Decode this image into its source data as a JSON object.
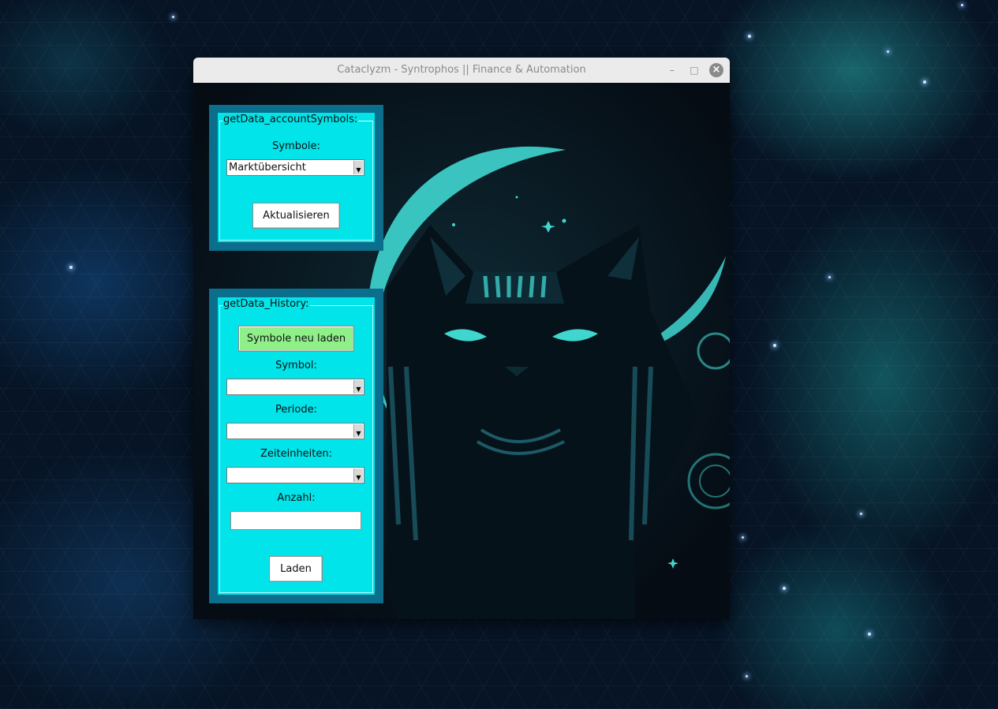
{
  "window": {
    "title": "Cataclyzm - Syntrophos || Finance & Automation",
    "controls": {
      "minimize": "–",
      "maximize": "□",
      "close": "×"
    }
  },
  "account_symbols": {
    "legend": "getData_accountSymbols:",
    "symbols_label": "Symbole:",
    "symbols_value": "Marktübersicht",
    "refresh_button": "Aktualisieren"
  },
  "history": {
    "legend": "getData_History:",
    "reload_button": "Symbole neu laden",
    "symbol_label": "Symbol:",
    "symbol_value": "",
    "period_label": "Periode:",
    "period_value": "",
    "time_units_label": "Zeiteinheiten:",
    "time_units_value": "",
    "count_label": "Anzahl:",
    "count_value": "",
    "load_button": "Laden"
  },
  "colors": {
    "panel_border": "#0b6e8c",
    "panel_fill": "#00e4ea",
    "reload_button_fill": "#8ff08a",
    "artwork_accent": "#3fd6d0"
  },
  "artwork": {
    "subject": "egyptian-cat-with-crescent-moon"
  }
}
